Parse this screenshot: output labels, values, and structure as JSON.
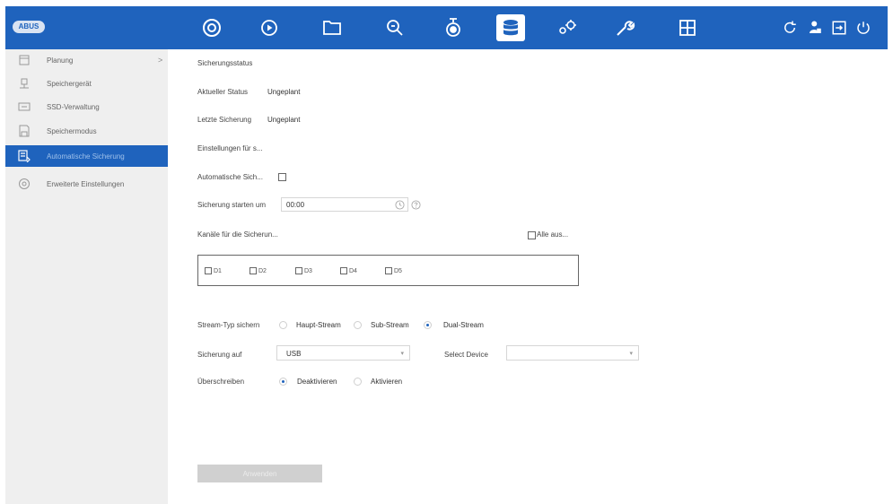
{
  "brand": {
    "logo_text": "ABUS"
  },
  "topnav": {
    "icons": [
      "live-view-icon",
      "playback-icon",
      "file-folder-icon",
      "search-icon",
      "camera-icon",
      "storage-database-icon",
      "network-settings-icon",
      "tools-wrench-icon",
      "grid-layout-icon"
    ],
    "active": "storage-database-icon",
    "right_icons": [
      "refresh-icon",
      "user-account-icon",
      "logout-icon",
      "power-icon"
    ]
  },
  "sidebar": {
    "items": [
      {
        "label": "Planung",
        "icon": "calendar-icon",
        "has_arrow": true,
        "arrow": ">"
      },
      {
        "label": "Speichergerät",
        "icon": "storage-device-icon"
      },
      {
        "label": "SSD-Verwaltung",
        "icon": "ssd-icon"
      },
      {
        "label": "Speichermodus",
        "icon": "storage-mode-icon"
      },
      {
        "label": "Automatische Sicherung",
        "icon": "backup-icon",
        "active": true
      },
      {
        "label": "Erweiterte Einstellungen",
        "icon": "advanced-settings-icon"
      }
    ]
  },
  "main": {
    "section_title": "Sicherungsstatus",
    "status_label": "Aktueller Status",
    "status_value": "Ungeplant",
    "last_backup_label": "Letzte Sicherung",
    "last_backup_value": "Ungeplant",
    "settings_title": "Einstellungen für s...",
    "auto_backup_label": "Automatische Sich...",
    "start_label": "Sicherung starten um",
    "start_time": "00:00",
    "channels_label": "Kanäle für die Sicherun...",
    "select_all_label": "Alle aus...",
    "channels": [
      "D1",
      "D2",
      "D3",
      "D4",
      "D5"
    ],
    "stream_type_label": "Stream-Typ sichern",
    "stream_options": [
      "Haupt-Stream",
      "Sub-Stream",
      "Dual-Stream"
    ],
    "stream_selected": "Dual-Stream",
    "backup_to_label": "Sicherung auf",
    "backup_to_value": "USB",
    "select_device_label": "Select Device",
    "select_device_value": "",
    "overwrite_label": "Überschreiben",
    "overwrite_options": [
      "Deaktivieren",
      "Aktivieren"
    ],
    "overwrite_selected": "Deaktivieren",
    "apply_button": "Anwenden"
  },
  "colors": {
    "accent": "#1f63bd",
    "sidebar_bg": "#efefef",
    "button_disabled": "#d0d0d0"
  }
}
